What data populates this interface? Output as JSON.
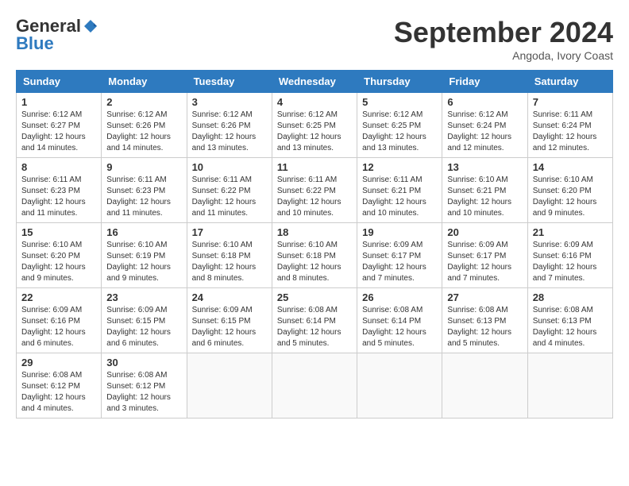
{
  "logo": {
    "general": "General",
    "blue": "Blue"
  },
  "title": "September 2024",
  "subtitle": "Angoda, Ivory Coast",
  "days_of_week": [
    "Sunday",
    "Monday",
    "Tuesday",
    "Wednesday",
    "Thursday",
    "Friday",
    "Saturday"
  ],
  "weeks": [
    [
      {
        "day": 1,
        "sunrise": "6:12 AM",
        "sunset": "6:27 PM",
        "daylight": "12 hours and 14 minutes."
      },
      {
        "day": 2,
        "sunrise": "6:12 AM",
        "sunset": "6:26 PM",
        "daylight": "12 hours and 14 minutes."
      },
      {
        "day": 3,
        "sunrise": "6:12 AM",
        "sunset": "6:26 PM",
        "daylight": "12 hours and 13 minutes."
      },
      {
        "day": 4,
        "sunrise": "6:12 AM",
        "sunset": "6:25 PM",
        "daylight": "12 hours and 13 minutes."
      },
      {
        "day": 5,
        "sunrise": "6:12 AM",
        "sunset": "6:25 PM",
        "daylight": "12 hours and 13 minutes."
      },
      {
        "day": 6,
        "sunrise": "6:12 AM",
        "sunset": "6:24 PM",
        "daylight": "12 hours and 12 minutes."
      },
      {
        "day": 7,
        "sunrise": "6:11 AM",
        "sunset": "6:24 PM",
        "daylight": "12 hours and 12 minutes."
      }
    ],
    [
      {
        "day": 8,
        "sunrise": "6:11 AM",
        "sunset": "6:23 PM",
        "daylight": "12 hours and 11 minutes."
      },
      {
        "day": 9,
        "sunrise": "6:11 AM",
        "sunset": "6:23 PM",
        "daylight": "12 hours and 11 minutes."
      },
      {
        "day": 10,
        "sunrise": "6:11 AM",
        "sunset": "6:22 PM",
        "daylight": "12 hours and 11 minutes."
      },
      {
        "day": 11,
        "sunrise": "6:11 AM",
        "sunset": "6:22 PM",
        "daylight": "12 hours and 10 minutes."
      },
      {
        "day": 12,
        "sunrise": "6:11 AM",
        "sunset": "6:21 PM",
        "daylight": "12 hours and 10 minutes."
      },
      {
        "day": 13,
        "sunrise": "6:10 AM",
        "sunset": "6:21 PM",
        "daylight": "12 hours and 10 minutes."
      },
      {
        "day": 14,
        "sunrise": "6:10 AM",
        "sunset": "6:20 PM",
        "daylight": "12 hours and 9 minutes."
      }
    ],
    [
      {
        "day": 15,
        "sunrise": "6:10 AM",
        "sunset": "6:20 PM",
        "daylight": "12 hours and 9 minutes."
      },
      {
        "day": 16,
        "sunrise": "6:10 AM",
        "sunset": "6:19 PM",
        "daylight": "12 hours and 9 minutes."
      },
      {
        "day": 17,
        "sunrise": "6:10 AM",
        "sunset": "6:18 PM",
        "daylight": "12 hours and 8 minutes."
      },
      {
        "day": 18,
        "sunrise": "6:10 AM",
        "sunset": "6:18 PM",
        "daylight": "12 hours and 8 minutes."
      },
      {
        "day": 19,
        "sunrise": "6:09 AM",
        "sunset": "6:17 PM",
        "daylight": "12 hours and 7 minutes."
      },
      {
        "day": 20,
        "sunrise": "6:09 AM",
        "sunset": "6:17 PM",
        "daylight": "12 hours and 7 minutes."
      },
      {
        "day": 21,
        "sunrise": "6:09 AM",
        "sunset": "6:16 PM",
        "daylight": "12 hours and 7 minutes."
      }
    ],
    [
      {
        "day": 22,
        "sunrise": "6:09 AM",
        "sunset": "6:16 PM",
        "daylight": "12 hours and 6 minutes."
      },
      {
        "day": 23,
        "sunrise": "6:09 AM",
        "sunset": "6:15 PM",
        "daylight": "12 hours and 6 minutes."
      },
      {
        "day": 24,
        "sunrise": "6:09 AM",
        "sunset": "6:15 PM",
        "daylight": "12 hours and 6 minutes."
      },
      {
        "day": 25,
        "sunrise": "6:08 AM",
        "sunset": "6:14 PM",
        "daylight": "12 hours and 5 minutes."
      },
      {
        "day": 26,
        "sunrise": "6:08 AM",
        "sunset": "6:14 PM",
        "daylight": "12 hours and 5 minutes."
      },
      {
        "day": 27,
        "sunrise": "6:08 AM",
        "sunset": "6:13 PM",
        "daylight": "12 hours and 5 minutes."
      },
      {
        "day": 28,
        "sunrise": "6:08 AM",
        "sunset": "6:13 PM",
        "daylight": "12 hours and 4 minutes."
      }
    ],
    [
      {
        "day": 29,
        "sunrise": "6:08 AM",
        "sunset": "6:12 PM",
        "daylight": "12 hours and 4 minutes."
      },
      {
        "day": 30,
        "sunrise": "6:08 AM",
        "sunset": "6:12 PM",
        "daylight": "12 hours and 3 minutes."
      },
      null,
      null,
      null,
      null,
      null
    ]
  ]
}
